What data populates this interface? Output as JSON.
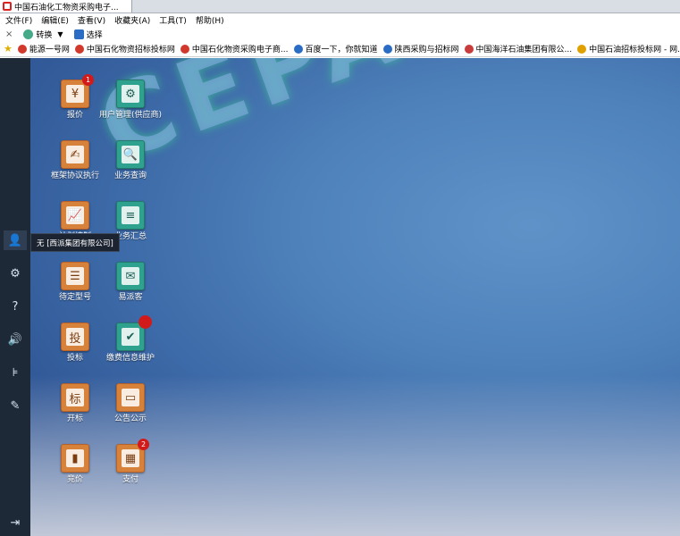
{
  "tab": {
    "title": "中国石油化工物资采购电子..."
  },
  "menu": [
    "文件(F)",
    "编辑(E)",
    "查看(V)",
    "收藏夹(A)",
    "工具(T)",
    "帮助(H)"
  ],
  "toolbar": {
    "close": "×",
    "convert": "转换",
    "select": "选择"
  },
  "bookmarks": [
    {
      "label": "能源一号网",
      "color": "#d0392b"
    },
    {
      "label": "中国石化物资招标投标网",
      "color": "#d0392b"
    },
    {
      "label": "中国石化物资采购电子商...",
      "color": "#d0392b"
    },
    {
      "label": "百度一下，你就知道",
      "color": "#2b6cc4"
    },
    {
      "label": "陕西采购与招标网",
      "color": "#2b6cc4"
    },
    {
      "label": "中国海洋石油集团有限公...",
      "color": "#c83c3c"
    },
    {
      "label": "中国石油招标投标网 - 网...",
      "color": "#e0a000"
    }
  ],
  "watermark": "CEPAI",
  "tooltip": "无 [西派集团有限公司]",
  "sidebar": [
    {
      "name": "user-icon",
      "glyph": "👤"
    },
    {
      "name": "gear-icon",
      "glyph": "⚙"
    },
    {
      "name": "help-icon",
      "glyph": "?"
    },
    {
      "name": "speaker-icon",
      "glyph": "🔊"
    },
    {
      "name": "filter-icon",
      "glyph": "⊧"
    },
    {
      "name": "document-icon",
      "glyph": "✎"
    },
    {
      "name": "logout-icon",
      "glyph": "⇥"
    }
  ],
  "desktop_icons": [
    {
      "label": "报价",
      "color": "orange",
      "glyph": "¥",
      "badge": "1"
    },
    {
      "label": "用户管理(供应商)",
      "color": "green",
      "glyph": "⚙",
      "badge": null
    },
    {
      "label": "框架协议执行",
      "color": "orange",
      "glyph": "✍",
      "badge": null
    },
    {
      "label": "业务查询",
      "color": "green",
      "glyph": "🔍",
      "badge": null
    },
    {
      "label": "计划控制",
      "color": "orange",
      "glyph": "📈",
      "badge": null
    },
    {
      "label": "业务汇总",
      "color": "green",
      "glyph": "≡",
      "badge": null
    },
    {
      "label": "待定型号",
      "color": "orange",
      "glyph": "☰",
      "badge": null
    },
    {
      "label": "易派客",
      "color": "green",
      "glyph": "✉",
      "badge": null
    },
    {
      "label": "投标",
      "color": "orange",
      "glyph": "投",
      "badge": null
    },
    {
      "label": "缴费信息维护",
      "color": "green",
      "glyph": "✔",
      "badge": ""
    },
    {
      "label": "开标",
      "color": "orange",
      "glyph": "标",
      "badge": null
    },
    {
      "label": "公告公示",
      "color": "orange",
      "glyph": "▭",
      "badge": null
    },
    {
      "label": "竞价",
      "color": "orange",
      "glyph": "▮",
      "badge": null
    },
    {
      "label": "支付",
      "color": "orange",
      "glyph": "▦",
      "badge": "2"
    }
  ]
}
